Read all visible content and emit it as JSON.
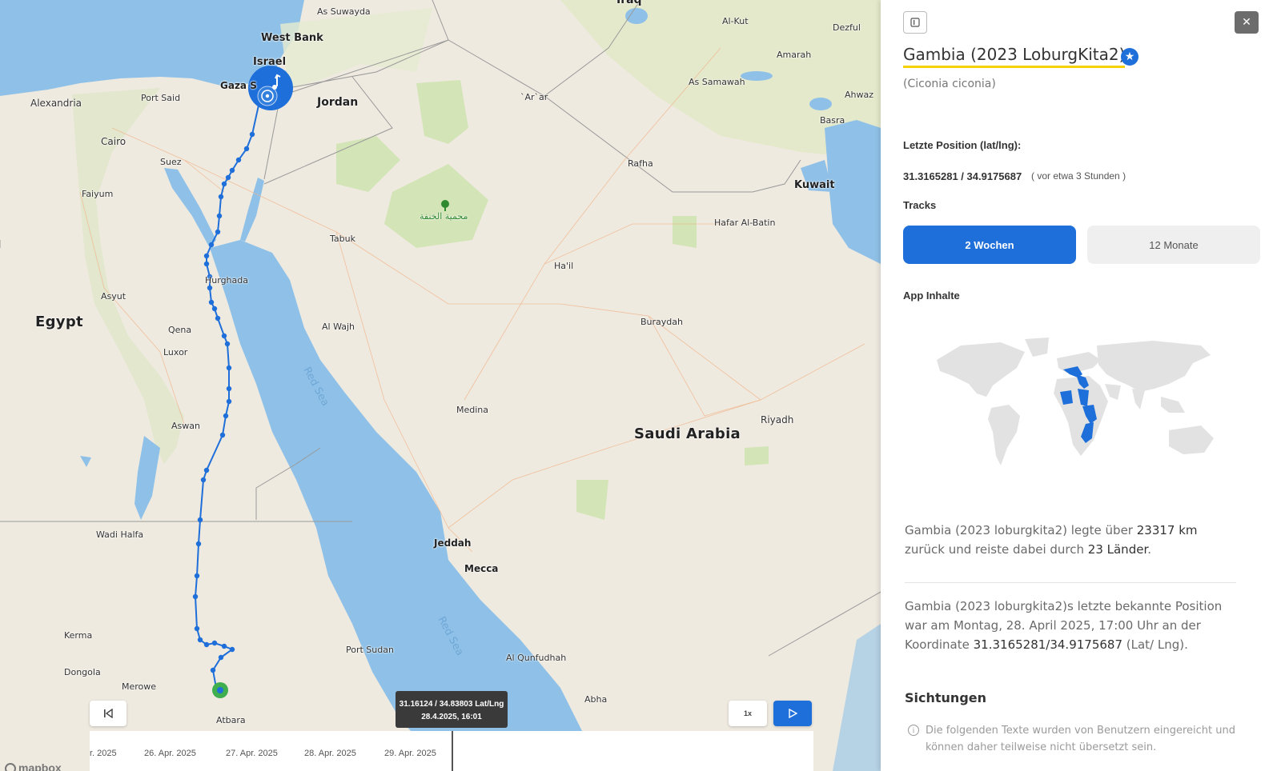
{
  "map": {
    "places": {
      "as_suwayda": "As Suwayda",
      "iraq": "Iraq",
      "al_kut": "Al-Kut",
      "dezful": "Dezful",
      "west_bank": "West Bank",
      "israel": "Israel",
      "gaza": "Gaza S",
      "amarah": "Amarah",
      "as_samawah": "As Samawah",
      "ahwaz": "Ahwaz",
      "alexandria": "Alexandria",
      "port_said": "Port Said",
      "jordan": "Jordan",
      "arar": "`Ar`ar",
      "basra": "Basra",
      "cairo": "Cairo",
      "suez": "Suez",
      "rafha": "Rafha",
      "kuwait": "Kuwait",
      "faiyum": "Faiyum",
      "park": "محمية الخنفة",
      "hafar": "Hafar Al-Batin",
      "tabuk": "Tabuk",
      "hail": "Ha'il",
      "hurghada": "Hurghada",
      "asyut": "Asyut",
      "egypt": "Egypt",
      "buraydah": "Buraydah",
      "al_wajh": "Al Wajh",
      "qena": "Qena",
      "luxor": "Luxor",
      "red_sea_1": "Red Sea",
      "medina": "Medina",
      "riyadh": "Riyadh",
      "aswan": "Aswan",
      "saudi": "Saudi Arabia",
      "wadi_halfa": "Wadi Halfa",
      "jeddah": "Jeddah",
      "mecca": "Mecca",
      "kerma": "Kerma",
      "red_sea_2": "Red Sea",
      "port_sudan": "Port Sudan",
      "al_qunfudhah": "Al Qunfudhah",
      "dongola": "Dongola",
      "merowe": "Merowe",
      "abha": "Abha",
      "atbara": "Atbara"
    },
    "tooltip": {
      "coords": "31.16124 / 34.83803 Lat/Lng",
      "datetime": "28.4.2025, 16:01"
    },
    "controls": {
      "speed": "1x"
    },
    "timeline_ticks": [
      "r. 2025",
      "26. Apr. 2025",
      "27. Apr. 2025",
      "28. Apr. 2025",
      "29. Apr. 2025"
    ],
    "logo": "mapbox",
    "track_color": "#1e6fd9"
  },
  "panel": {
    "title": "Gambia (2023 LoburgKita2)",
    "scientific_name": "(Ciconia ciconia)",
    "last_position_label": "Letzte Position (lat/lng):",
    "last_position_value": "31.3165281 / 34.9175687",
    "last_position_ago": "( vor etwa 3 Stunden )",
    "tracks_label": "Tracks",
    "track_2w": "2 Wochen",
    "track_12m": "12 Monate",
    "app_inhalte_label": "App Inhalte",
    "summary": {
      "p1_a": "Gambia (2023 loburgkita2) legte über ",
      "p1_km": "23317 km",
      "p1_b": " zurück und reiste dabei durch ",
      "p1_countries": "23 Länder",
      "p1_c": ".",
      "p2_a": "Gambia (2023 loburgkita2)s letzte bekannte Position war am Montag, 28. April 2025, 17:00 Uhr an der Koordinate ",
      "p2_coord": "31.3165281/34.9175687",
      "p2_b": " (Lat/ Lng)."
    },
    "sightings_title": "Sichtungen",
    "sightings_notice": "Die folgenden Texte wurden von Benutzern eingereicht und können daher teilweise nicht übersetzt sein.",
    "accent": "#1e6fd9",
    "highlight": "#f5d200"
  }
}
